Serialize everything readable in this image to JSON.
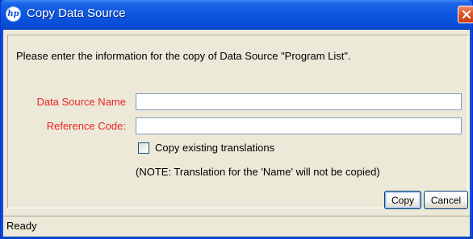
{
  "window": {
    "title": "Copy Data Source",
    "logo_text": "hp",
    "logo_icon": "hp-logo-icon",
    "close_icon": "close-icon",
    "titlebar_color": "#0b55e0",
    "close_color": "#e0532a"
  },
  "form": {
    "instruction": "Please enter the information for the copy of Data Source \"Program List\".",
    "fields": [
      {
        "label": "Data Source Name",
        "value": "",
        "placeholder": ""
      },
      {
        "label": "Reference Code:",
        "value": "",
        "placeholder": ""
      }
    ],
    "checkbox": {
      "label": "Copy existing translations",
      "checked": false
    },
    "note": "(NOTE: Translation for the 'Name' will not be copied)",
    "required_label_color": "#ee2222"
  },
  "buttons": {
    "copy": "Copy",
    "cancel": "Cancel"
  },
  "status": {
    "text": "Ready"
  }
}
